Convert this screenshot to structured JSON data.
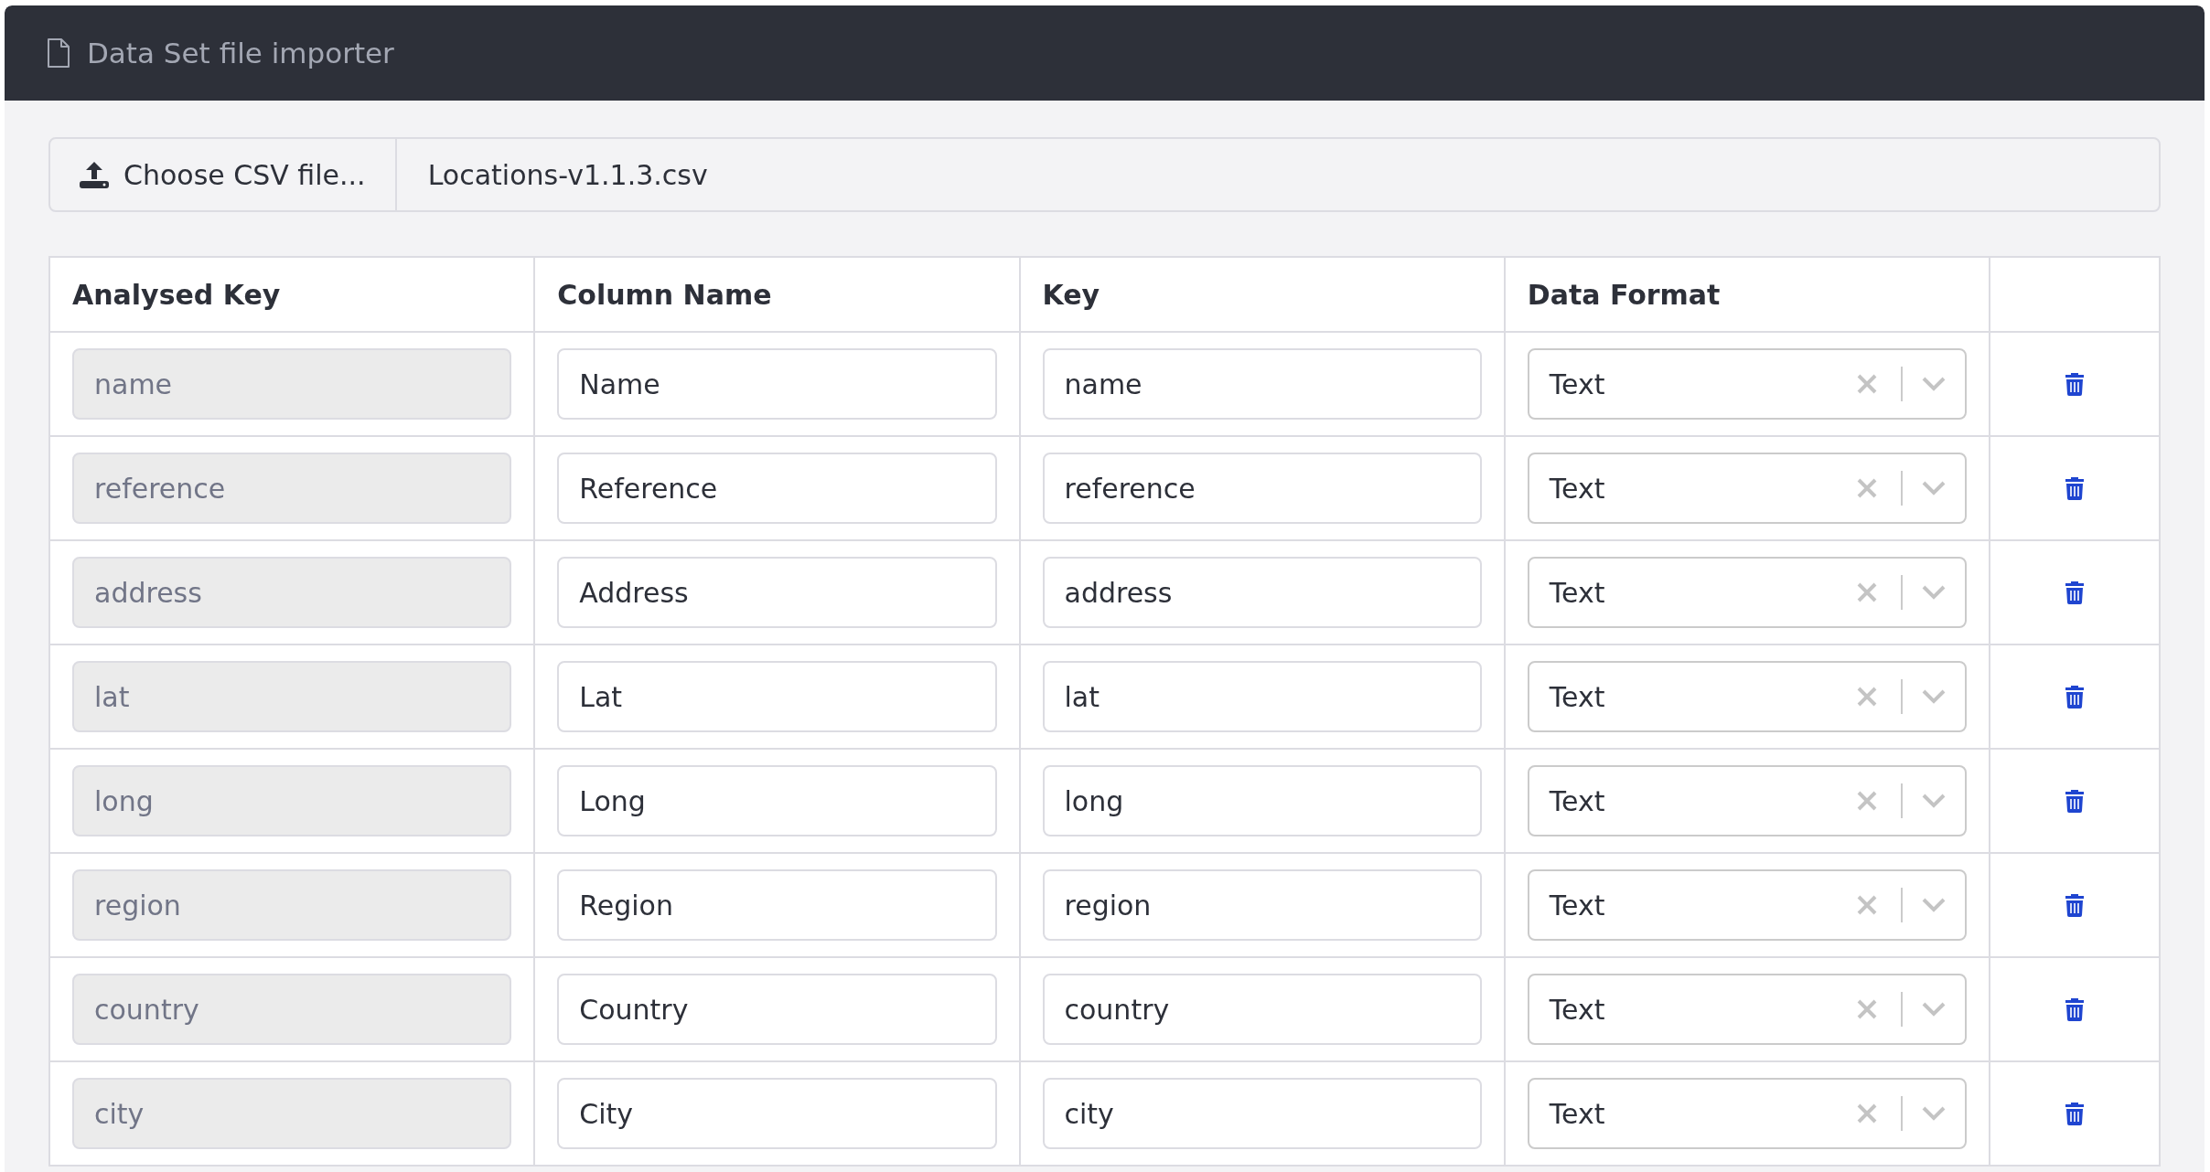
{
  "window": {
    "title": "Data Set file importer"
  },
  "file_picker": {
    "button": "Choose CSV file...",
    "file_name": "Locations-v1.1.3.csv"
  },
  "table": {
    "columns": [
      "Analysed Key",
      "Column Name",
      "Key",
      "Data Format"
    ],
    "rows": [
      {
        "analysed_key": "name",
        "column_name": "Name",
        "key": "name",
        "data_format": "Text"
      },
      {
        "analysed_key": "reference",
        "column_name": "Reference",
        "key": "reference",
        "data_format": "Text"
      },
      {
        "analysed_key": "address",
        "column_name": "Address",
        "key": "address",
        "data_format": "Text"
      },
      {
        "analysed_key": "lat",
        "column_name": "Lat",
        "key": "lat",
        "data_format": "Text"
      },
      {
        "analysed_key": "long",
        "column_name": "Long",
        "key": "long",
        "data_format": "Text"
      },
      {
        "analysed_key": "region",
        "column_name": "Region",
        "key": "region",
        "data_format": "Text"
      },
      {
        "analysed_key": "country",
        "column_name": "Country",
        "key": "country",
        "data_format": "Text"
      },
      {
        "analysed_key": "city",
        "column_name": "City",
        "key": "city",
        "data_format": "Text"
      }
    ]
  }
}
